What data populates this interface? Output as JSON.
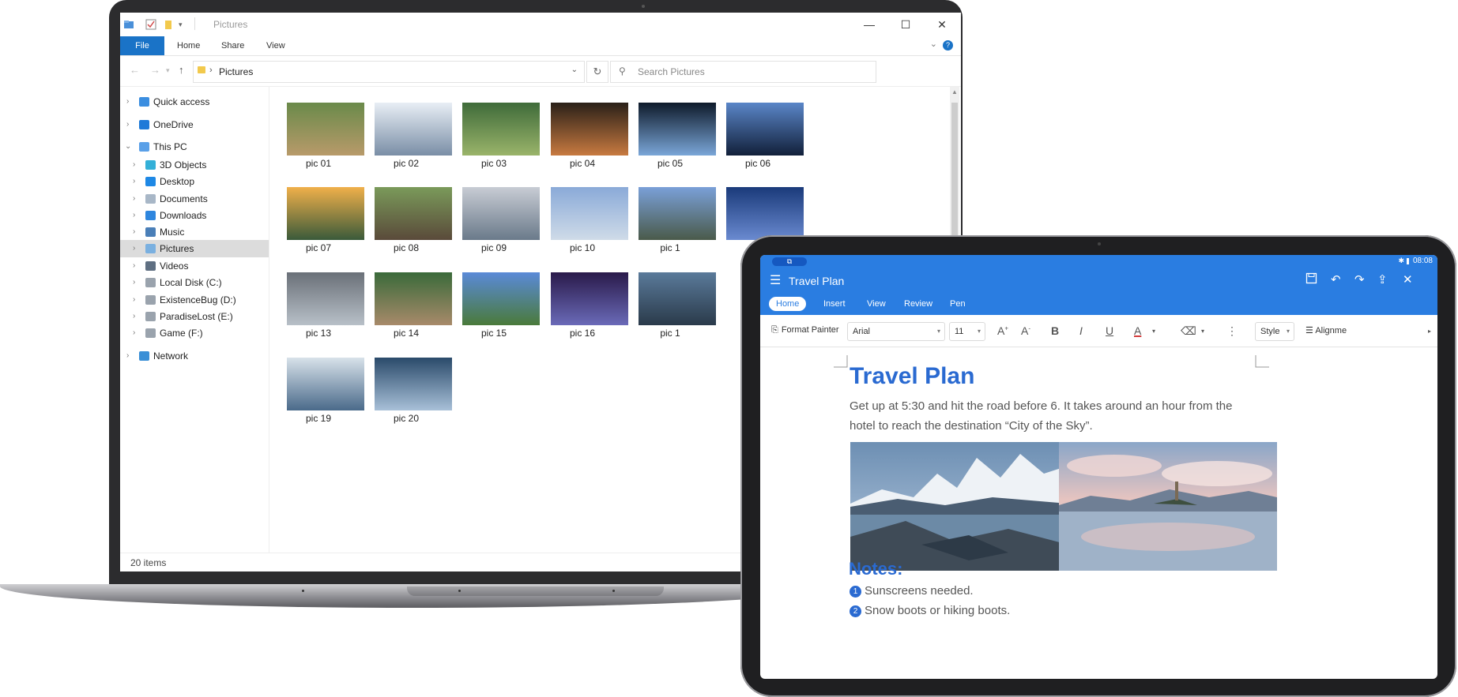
{
  "explorer": {
    "window_title": "Pictures",
    "ribbon": {
      "file": "File",
      "tabs": [
        "Home",
        "Share",
        "View"
      ],
      "help": "?"
    },
    "address": {
      "path": "Pictures",
      "separator": "›"
    },
    "search": {
      "placeholder": "Search Pictures"
    },
    "nav": [
      {
        "label": "Quick access"
      },
      {
        "label": "OneDrive"
      },
      {
        "label": "This PC"
      },
      {
        "label": "3D Objects"
      },
      {
        "label": "Desktop"
      },
      {
        "label": "Documents"
      },
      {
        "label": "Downloads"
      },
      {
        "label": "Music"
      },
      {
        "label": "Pictures"
      },
      {
        "label": "Videos"
      },
      {
        "label": "Local Disk (C:)"
      },
      {
        "label": "ExistenceBug (D:)"
      },
      {
        "label": "ParadiseLost (E:)"
      },
      {
        "label": "Game (F:)"
      },
      {
        "label": "Network"
      }
    ],
    "thumbnails": [
      "pic 01",
      "pic 02",
      "pic 03",
      "pic 04",
      "pic 05",
      "pic 06",
      "pic 07",
      "pic 08",
      "pic 09",
      "pic 10",
      "pic 1",
      "pic 13",
      "pic 14",
      "pic 15",
      "pic 16",
      "pic 1",
      "pic 19",
      "pic 20"
    ],
    "status": "20 items"
  },
  "tablet": {
    "status_time": "08:08",
    "doc_title": "Travel Plan",
    "tabs": [
      "Home",
      "Insert",
      "View",
      "Review",
      "Pen"
    ],
    "toolbar": {
      "format_painter": "Format Painter",
      "font": "Arial",
      "font_size": "11",
      "bold": "B",
      "italic": "I",
      "underline": "U",
      "font_color": "A",
      "style": "Style",
      "alignment": "Alignme"
    },
    "document": {
      "heading": "Travel Plan",
      "paragraph": "Get up at 5:30 and hit the road before 6. It takes around an hour from the hotel to reach the destination “City of the Sky”.",
      "notes_heading": "Notes:",
      "notes": [
        {
          "num": "1",
          "text": "Sunscreens needed."
        },
        {
          "num": "2",
          "text": "Snow boots or hiking boots."
        }
      ]
    }
  },
  "colors": {
    "explorer_accent": "#1a73c7",
    "doc_accent": "#2a7de1",
    "doc_heading": "#2a6ad1"
  }
}
